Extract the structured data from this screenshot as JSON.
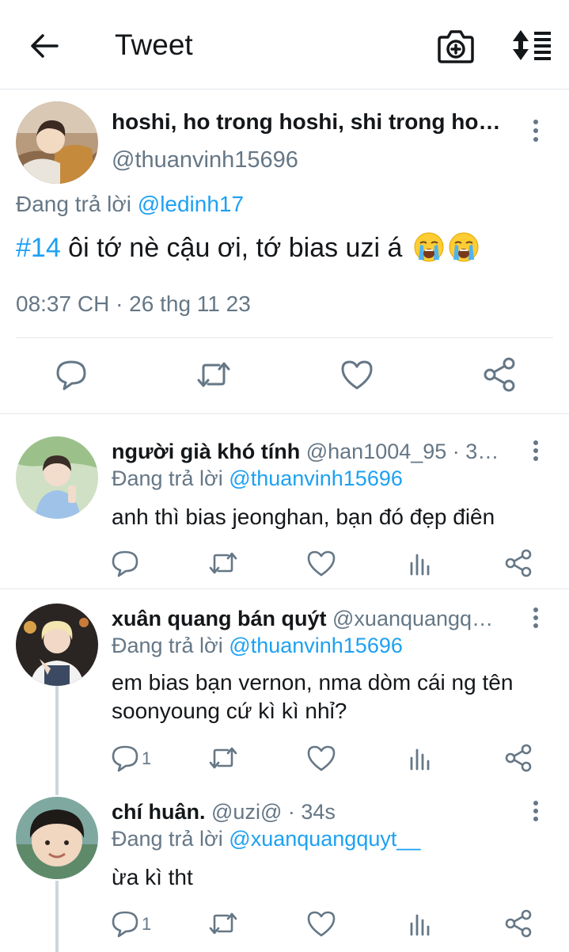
{
  "header": {
    "title": "Tweet",
    "back_icon": "arrow-left-icon",
    "camera_icon": "camera-plus-icon",
    "sort_icon": "sort-order-icon"
  },
  "main_tweet": {
    "display_name": "hoshi, ho trong hoshi, shi trong ho…",
    "handle": "@thuanvinh15696",
    "replying_prefix": "Đang trả lời",
    "replying_to": "@ledinh17",
    "hashtag": "#14",
    "text": " ôi tớ nè cậu ơi, tớ bias uzi á",
    "emoji": [
      "loudly-crying-face",
      "loudly-crying-face"
    ],
    "timestamp": "08:37 CH · 26 thg 11 23",
    "actions": [
      "reply-icon",
      "retweet-icon",
      "like-icon",
      "share-icon"
    ]
  },
  "replies": [
    {
      "display_name": "người già khó tính",
      "meta": " @han1004_95 · 3…",
      "replying_prefix": "Đang trả lời",
      "replying_to": "@thuanvinh15696",
      "text": "anh thì bias jeonghan, bạn đó đẹp điên",
      "reply_count": ""
    },
    {
      "display_name": "xuân quang bán quýt",
      "meta": " @xuanquangq…",
      "replying_prefix": "Đang trả lời",
      "replying_to": "@thuanvinh15696",
      "text": "em bias bạn vernon, nma dòm cái ng tên soonyoung cứ kì kì nhỉ?",
      "reply_count": "1"
    },
    {
      "display_name": "chí huân.",
      "meta": " @uzi@ · 34s",
      "replying_prefix": "Đang trả lời",
      "replying_to": "@xuanquangquyt__",
      "text": "ừa kì tht",
      "reply_count": "1"
    }
  ],
  "colors": {
    "accent": "#1da1f2",
    "secondary_text": "#657786",
    "divider": "#e1e8ed"
  }
}
